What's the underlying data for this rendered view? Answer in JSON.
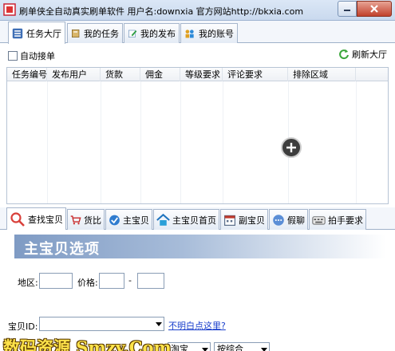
{
  "titlebar": {
    "title": "刷单侠全自动真实刷单软件   用户名:downxia      官方网站http://bkxia.com"
  },
  "top_tabs": [
    {
      "label": "任务大厅",
      "icon": "list-icon"
    },
    {
      "label": "我的任务",
      "icon": "book-icon"
    },
    {
      "label": "我的发布",
      "icon": "edit-icon"
    },
    {
      "label": "我的账号",
      "icon": "users-icon"
    }
  ],
  "toolbar": {
    "auto_accept_label": "自动接单",
    "refresh_label": "刷新大厅"
  },
  "task_table": {
    "columns": [
      "任务编号",
      "发布用户",
      "货款",
      "佣金",
      "等级要求",
      "评论要求",
      "排除区域"
    ],
    "rows": []
  },
  "bottom_tabs": [
    {
      "label": "查找宝贝",
      "icon": "search-icon"
    },
    {
      "label": "货比",
      "icon": "cart-icon"
    },
    {
      "label": "主宝贝",
      "icon": "check-icon"
    },
    {
      "label": "主宝贝首页",
      "icon": "home-icon"
    },
    {
      "label": "副宝贝",
      "icon": "calendar-icon"
    },
    {
      "label": "假聊",
      "icon": "chat-icon"
    },
    {
      "label": "拍手要求",
      "icon": "keyboard-icon"
    }
  ],
  "form": {
    "banner_title": "主宝贝选项",
    "region_label": "地区:",
    "region_value": "",
    "price_label": "价格:",
    "price_min": "",
    "price_dash": "-",
    "price_max": "",
    "item_id_label": "宝贝ID:",
    "item_id_value": "",
    "help_link": "不明白点这里?",
    "platform_value": "淘宝",
    "sort_value": "按综合"
  },
  "watermark": "数码资源 Smzy.Com",
  "colors": {
    "banner_start": "#7f9bc4",
    "link": "#1a3fcc",
    "close_button": "#c1412c"
  }
}
